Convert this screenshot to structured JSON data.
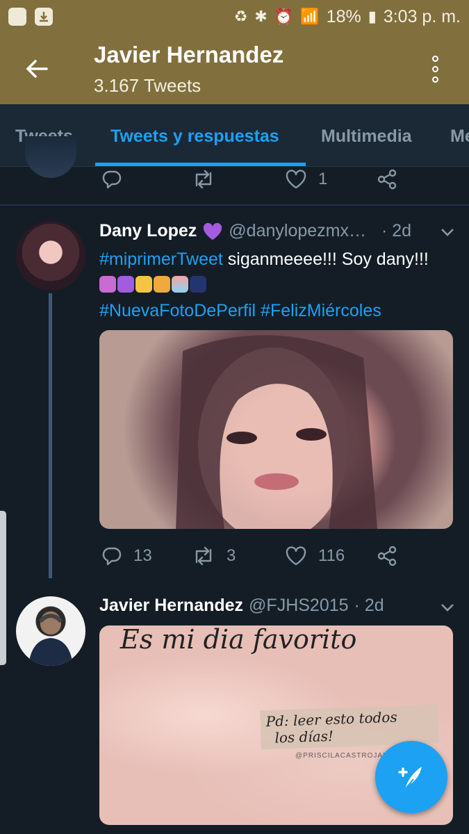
{
  "status_bar": {
    "battery": "18%",
    "time": "3:03 p. m."
  },
  "header": {
    "title": "Javier Hernandez",
    "subtitle": "3.167 Tweets"
  },
  "tabs": [
    {
      "label": "Tweets",
      "active": false
    },
    {
      "label": "Tweets y respuestas",
      "active": true
    },
    {
      "label": "Multimedia",
      "active": false
    },
    {
      "label": "Me",
      "active": false
    }
  ],
  "top_actions": {
    "reply_count": "",
    "retweet_count": "",
    "like_count": "1"
  },
  "tweet1": {
    "name": "Dany Lopez",
    "name_emoji": "purple-heart",
    "handle": "@danylopezmx…",
    "time": "· 2d",
    "hashtag1": "#miprimerTweet",
    "text1": " siganmeeee!!! Soy dany!!! ",
    "hashtag2": "#NuevaFotoDePerfil",
    "hashtag3": "#FelizMiércoles",
    "reply_count": "13",
    "retweet_count": "3",
    "like_count": "116"
  },
  "tweet2": {
    "name": "Javier Hernandez",
    "handle": "@FJHS2015",
    "time": "· 2d",
    "image_text_line1": "Es mi dia favorito",
    "image_text_line2": "Pd: leer esto todos",
    "image_text_line3": "los días!",
    "image_watermark": "@PRISCILACASTROJARA"
  },
  "colors": {
    "brand": "#816f3d",
    "accent": "#1da1f2",
    "background": "#141d26"
  }
}
